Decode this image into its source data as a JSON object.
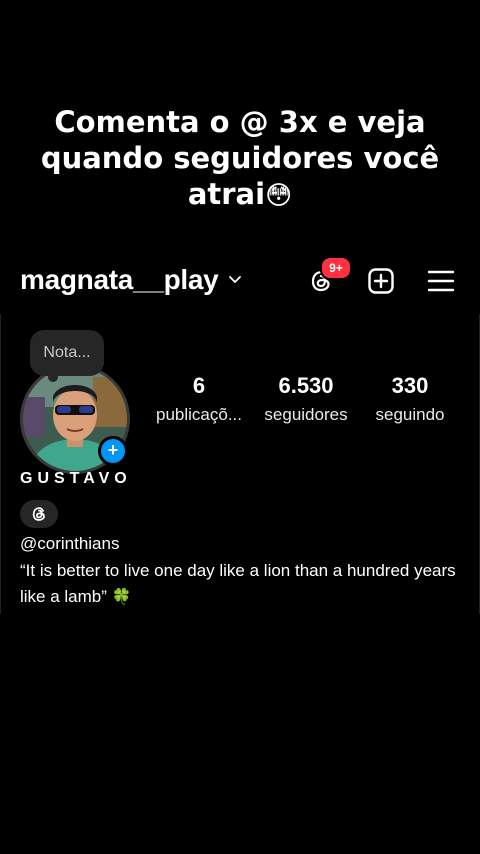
{
  "caption": {
    "line1": "Comenta o @ 3x e veja",
    "line2": "quando seguidores você",
    "line3": "atrai",
    "emoji": "😳"
  },
  "header": {
    "username": "magnata__play",
    "threads_badge": "9+"
  },
  "profile": {
    "note": "Nota...",
    "display_name": "GUSTAVO",
    "handle": "@corinthians",
    "bio": "“It is better to live one day like a lion than a hundred years like a lamb”",
    "bio_emoji": "🍀"
  },
  "stats": {
    "posts_value": "6",
    "posts_label": "publicaçõ...",
    "followers_value": "6.530",
    "followers_label": "seguidores",
    "following_value": "330",
    "following_label": "seguindo"
  },
  "icons": {
    "chevron": "chevron-down-icon",
    "threads": "threads-icon",
    "add": "add-post-icon",
    "menu": "hamburger-menu-icon",
    "avatar_add": "plus-icon"
  },
  "colors": {
    "background": "#000000",
    "badge": "#ff3040",
    "accent_blue": "#0095f6",
    "pill": "#262626"
  }
}
